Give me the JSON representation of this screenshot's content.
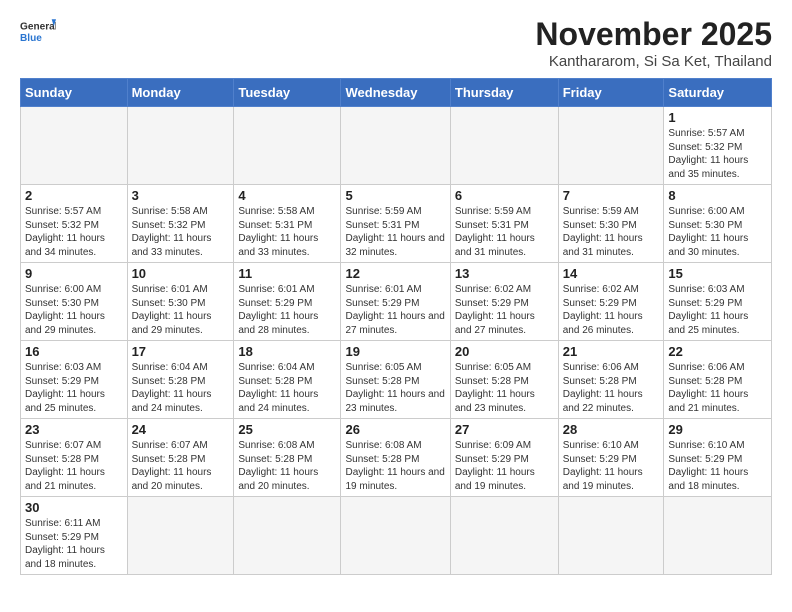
{
  "header": {
    "logo_general": "General",
    "logo_blue": "Blue",
    "month_title": "November 2025",
    "location": "Kanthararom, Si Sa Ket, Thailand"
  },
  "weekdays": [
    "Sunday",
    "Monday",
    "Tuesday",
    "Wednesday",
    "Thursday",
    "Friday",
    "Saturday"
  ],
  "days": [
    {
      "num": "",
      "sunrise": "",
      "sunset": "",
      "daylight": "",
      "empty": true
    },
    {
      "num": "",
      "sunrise": "",
      "sunset": "",
      "daylight": "",
      "empty": true
    },
    {
      "num": "",
      "sunrise": "",
      "sunset": "",
      "daylight": "",
      "empty": true
    },
    {
      "num": "",
      "sunrise": "",
      "sunset": "",
      "daylight": "",
      "empty": true
    },
    {
      "num": "",
      "sunrise": "",
      "sunset": "",
      "daylight": "",
      "empty": true
    },
    {
      "num": "",
      "sunrise": "",
      "sunset": "",
      "daylight": "",
      "empty": true
    },
    {
      "num": "1",
      "sunrise": "Sunrise: 5:57 AM",
      "sunset": "Sunset: 5:32 PM",
      "daylight": "Daylight: 11 hours and 35 minutes.",
      "empty": false
    },
    {
      "num": "2",
      "sunrise": "Sunrise: 5:57 AM",
      "sunset": "Sunset: 5:32 PM",
      "daylight": "Daylight: 11 hours and 34 minutes.",
      "empty": false
    },
    {
      "num": "3",
      "sunrise": "Sunrise: 5:58 AM",
      "sunset": "Sunset: 5:32 PM",
      "daylight": "Daylight: 11 hours and 33 minutes.",
      "empty": false
    },
    {
      "num": "4",
      "sunrise": "Sunrise: 5:58 AM",
      "sunset": "Sunset: 5:31 PM",
      "daylight": "Daylight: 11 hours and 33 minutes.",
      "empty": false
    },
    {
      "num": "5",
      "sunrise": "Sunrise: 5:59 AM",
      "sunset": "Sunset: 5:31 PM",
      "daylight": "Daylight: 11 hours and 32 minutes.",
      "empty": false
    },
    {
      "num": "6",
      "sunrise": "Sunrise: 5:59 AM",
      "sunset": "Sunset: 5:31 PM",
      "daylight": "Daylight: 11 hours and 31 minutes.",
      "empty": false
    },
    {
      "num": "7",
      "sunrise": "Sunrise: 5:59 AM",
      "sunset": "Sunset: 5:30 PM",
      "daylight": "Daylight: 11 hours and 31 minutes.",
      "empty": false
    },
    {
      "num": "8",
      "sunrise": "Sunrise: 6:00 AM",
      "sunset": "Sunset: 5:30 PM",
      "daylight": "Daylight: 11 hours and 30 minutes.",
      "empty": false
    },
    {
      "num": "9",
      "sunrise": "Sunrise: 6:00 AM",
      "sunset": "Sunset: 5:30 PM",
      "daylight": "Daylight: 11 hours and 29 minutes.",
      "empty": false
    },
    {
      "num": "10",
      "sunrise": "Sunrise: 6:01 AM",
      "sunset": "Sunset: 5:30 PM",
      "daylight": "Daylight: 11 hours and 29 minutes.",
      "empty": false
    },
    {
      "num": "11",
      "sunrise": "Sunrise: 6:01 AM",
      "sunset": "Sunset: 5:29 PM",
      "daylight": "Daylight: 11 hours and 28 minutes.",
      "empty": false
    },
    {
      "num": "12",
      "sunrise": "Sunrise: 6:01 AM",
      "sunset": "Sunset: 5:29 PM",
      "daylight": "Daylight: 11 hours and 27 minutes.",
      "empty": false
    },
    {
      "num": "13",
      "sunrise": "Sunrise: 6:02 AM",
      "sunset": "Sunset: 5:29 PM",
      "daylight": "Daylight: 11 hours and 27 minutes.",
      "empty": false
    },
    {
      "num": "14",
      "sunrise": "Sunrise: 6:02 AM",
      "sunset": "Sunset: 5:29 PM",
      "daylight": "Daylight: 11 hours and 26 minutes.",
      "empty": false
    },
    {
      "num": "15",
      "sunrise": "Sunrise: 6:03 AM",
      "sunset": "Sunset: 5:29 PM",
      "daylight": "Daylight: 11 hours and 25 minutes.",
      "empty": false
    },
    {
      "num": "16",
      "sunrise": "Sunrise: 6:03 AM",
      "sunset": "Sunset: 5:29 PM",
      "daylight": "Daylight: 11 hours and 25 minutes.",
      "empty": false
    },
    {
      "num": "17",
      "sunrise": "Sunrise: 6:04 AM",
      "sunset": "Sunset: 5:28 PM",
      "daylight": "Daylight: 11 hours and 24 minutes.",
      "empty": false
    },
    {
      "num": "18",
      "sunrise": "Sunrise: 6:04 AM",
      "sunset": "Sunset: 5:28 PM",
      "daylight": "Daylight: 11 hours and 24 minutes.",
      "empty": false
    },
    {
      "num": "19",
      "sunrise": "Sunrise: 6:05 AM",
      "sunset": "Sunset: 5:28 PM",
      "daylight": "Daylight: 11 hours and 23 minutes.",
      "empty": false
    },
    {
      "num": "20",
      "sunrise": "Sunrise: 6:05 AM",
      "sunset": "Sunset: 5:28 PM",
      "daylight": "Daylight: 11 hours and 23 minutes.",
      "empty": false
    },
    {
      "num": "21",
      "sunrise": "Sunrise: 6:06 AM",
      "sunset": "Sunset: 5:28 PM",
      "daylight": "Daylight: 11 hours and 22 minutes.",
      "empty": false
    },
    {
      "num": "22",
      "sunrise": "Sunrise: 6:06 AM",
      "sunset": "Sunset: 5:28 PM",
      "daylight": "Daylight: 11 hours and 21 minutes.",
      "empty": false
    },
    {
      "num": "23",
      "sunrise": "Sunrise: 6:07 AM",
      "sunset": "Sunset: 5:28 PM",
      "daylight": "Daylight: 11 hours and 21 minutes.",
      "empty": false
    },
    {
      "num": "24",
      "sunrise": "Sunrise: 6:07 AM",
      "sunset": "Sunset: 5:28 PM",
      "daylight": "Daylight: 11 hours and 20 minutes.",
      "empty": false
    },
    {
      "num": "25",
      "sunrise": "Sunrise: 6:08 AM",
      "sunset": "Sunset: 5:28 PM",
      "daylight": "Daylight: 11 hours and 20 minutes.",
      "empty": false
    },
    {
      "num": "26",
      "sunrise": "Sunrise: 6:08 AM",
      "sunset": "Sunset: 5:28 PM",
      "daylight": "Daylight: 11 hours and 19 minutes.",
      "empty": false
    },
    {
      "num": "27",
      "sunrise": "Sunrise: 6:09 AM",
      "sunset": "Sunset: 5:29 PM",
      "daylight": "Daylight: 11 hours and 19 minutes.",
      "empty": false
    },
    {
      "num": "28",
      "sunrise": "Sunrise: 6:10 AM",
      "sunset": "Sunset: 5:29 PM",
      "daylight": "Daylight: 11 hours and 19 minutes.",
      "empty": false
    },
    {
      "num": "29",
      "sunrise": "Sunrise: 6:10 AM",
      "sunset": "Sunset: 5:29 PM",
      "daylight": "Daylight: 11 hours and 18 minutes.",
      "empty": false
    },
    {
      "num": "30",
      "sunrise": "Sunrise: 6:11 AM",
      "sunset": "Sunset: 5:29 PM",
      "daylight": "Daylight: 11 hours and 18 minutes.",
      "empty": false
    },
    {
      "num": "",
      "sunrise": "",
      "sunset": "",
      "daylight": "",
      "empty": true
    },
    {
      "num": "",
      "sunrise": "",
      "sunset": "",
      "daylight": "",
      "empty": true
    },
    {
      "num": "",
      "sunrise": "",
      "sunset": "",
      "daylight": "",
      "empty": true
    },
    {
      "num": "",
      "sunrise": "",
      "sunset": "",
      "daylight": "",
      "empty": true
    },
    {
      "num": "",
      "sunrise": "",
      "sunset": "",
      "daylight": "",
      "empty": true
    },
    {
      "num": "",
      "sunrise": "",
      "sunset": "",
      "daylight": "",
      "empty": true
    }
  ]
}
